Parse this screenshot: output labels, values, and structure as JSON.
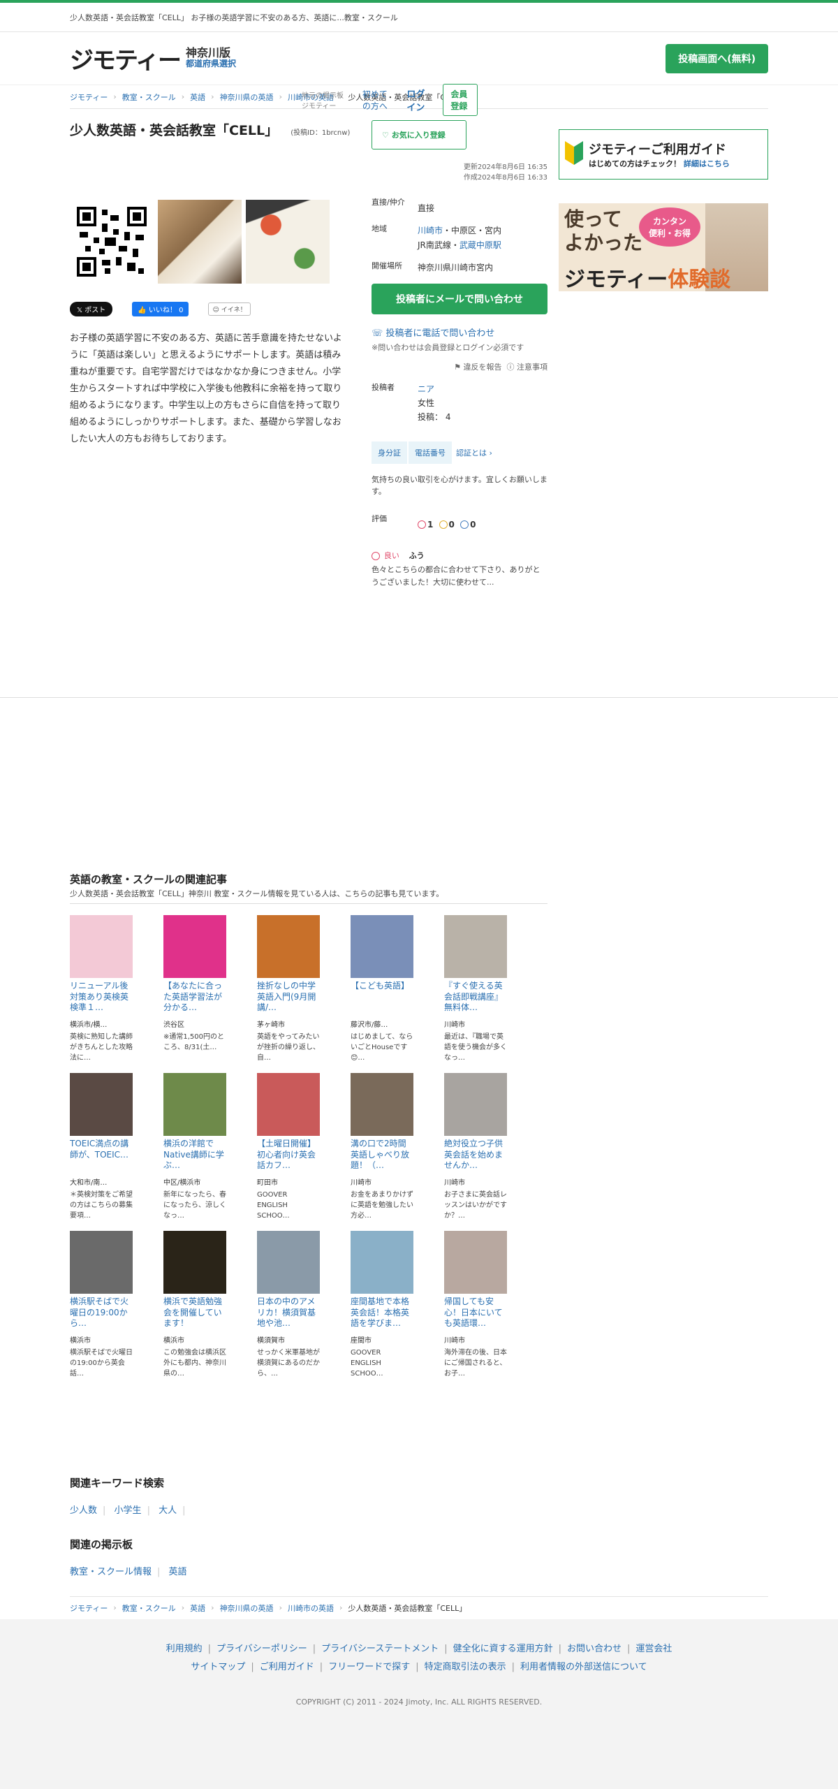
{
  "topbar": {
    "lead": "少人数英語・英会話教室「CELL」 お子様の英語学習に不安のある方、英語に...教室・スクール",
    "site_label": "地元の掲示板 ジモティー",
    "first_time": "初めての方へ",
    "login": "ログイン",
    "signup": "会員登録"
  },
  "header": {
    "logo": "ジモティー",
    "edition": "神奈川版",
    "pref_select": "都道府県選択",
    "post_button": "投稿画面へ(無料)"
  },
  "breadcrumb": [
    "ジモティー",
    "教室・スクール",
    "英語",
    "神奈川県の英語",
    "川崎市の英語",
    "少人数英語・英会話教室「CELL」"
  ],
  "post": {
    "title": "少人数英語・英会話教室「CELL」",
    "post_id": "(投稿ID：1brcnw)",
    "favorite": "お気に入り登録",
    "updated": "更新2024年8月6日 16:35",
    "created": "作成2024年8月6日 16:33",
    "description": "お子様の英語学習に不安のある方、英語に苦手意識を持たせないように「英語は楽しい」と思えるようにサポートします。英語は積み重ねが重要です。自宅学習だけではなかなか身につきません。小学生からスタートすれば中学校に入学後も他教科に余裕を持って取り組めるようになります。中学生以上の方もさらに自信を持って取り組めるようにしっかりサポートします。また、基礎から学習しなおしたい大人の方もお待ちしております。",
    "share": {
      "x": "ポスト",
      "fb": "いいね！ 0",
      "iinee": "イイネ！"
    }
  },
  "info": {
    "direct_label": "直接/仲介",
    "direct_value": "直接",
    "area_label": "地域",
    "area_city": "川崎市",
    "area_rest": "・中原区・宮内",
    "area_line": "JR南武線・",
    "area_station": "武蔵中原駅",
    "venue_label": "開催場所",
    "venue_value": "神奈川県川崎市宮内",
    "mail_button": "投稿者にメールで問い合わせ",
    "tel_link": "投稿者に電話で問い合わせ",
    "login_note": "※問い合わせは会員登録とログイン必須です",
    "report": "違反を報告",
    "caution": "注意事項",
    "poster_label": "投稿者",
    "poster_name": "ニア",
    "poster_gender": "女性",
    "poster_count": "投稿： 4",
    "badge_id": "身分証",
    "badge_tel": "電話番号",
    "cert_link": "認証とは",
    "greeting": "気持ちの良い取引を心がけます。宜しくお願いします。",
    "rating_label": "評価",
    "rating_good": "1",
    "rating_mid": "0",
    "rating_bad": "0",
    "review_tag": "良い",
    "review_user": "ふう",
    "review_text": "色々とこちらの都合に合わせて下さり、ありがとうございました！大切に使わせて..."
  },
  "side": {
    "guide_title": "ジモティーご利用ガイド",
    "guide_sub": "はじめての方はチェック！",
    "guide_link": "詳細はこちら",
    "banner_l1": "使って",
    "banner_l2": "よかった",
    "banner_brand": "ジモティー",
    "banner_tail": "体験談",
    "banner_bubble1": "カンタン",
    "banner_bubble2": "便利・お得"
  },
  "related": {
    "title": "英語の教室・スクールの関連記事",
    "sub": "少人数英語・英会話教室「CELL」神奈川 教室・スクール情報を見ている人は、こちらの記事も見ています。",
    "cards": [
      {
        "title": "リニューアル後対策あり英検英検準１…",
        "loc": "横浜市/横…",
        "desc": "英検に熟知した講師がきちんとした攻略法に…",
        "color": "#f3c9d6"
      },
      {
        "title": "【あなたに合った英語学習法が分かる…",
        "loc": "渋谷区",
        "desc": "※通常1,500円のところ、8/31(土…",
        "color": "#e0318a"
      },
      {
        "title": "挫折なしの中学英語入門(9月開講/…",
        "loc": "茅ヶ崎市",
        "desc": "英語をやってみたいが挫折の繰り返し、自…",
        "color": "#c8702a"
      },
      {
        "title": "【こども英語】",
        "loc": "藤沢市/藤…",
        "desc": "はじめまして、ならいごとHouseです😊…",
        "color": "#7a8fb8"
      },
      {
        "title": "『すぐ使える英会話即戦講座』無料体…",
        "loc": "川崎市",
        "desc": "最近は、『職場で英語を使う機会が多くなっ…",
        "color": "#b9b2a8"
      },
      {
        "title": "TOEIC満点の講師が、TOEIC…",
        "loc": "大和市/南…",
        "desc": "＊英検対策をご希望の方はこちらの募集要項…",
        "color": "#5a4a44"
      },
      {
        "title": "横浜の洋館でNative講師に学ぶ…",
        "loc": "中区/横浜市",
        "desc": "新年になったら、春になったら、涼しくなっ…",
        "color": "#6e8a4a"
      },
      {
        "title": "【土曜日開催】初心者向け英会話カフ…",
        "loc": "町田市",
        "desc": "GOOVER ENGLISH SCHOO…",
        "color": "#c95a5a"
      },
      {
        "title": "溝の口で2時間英語しゃべり放題！（…",
        "loc": "川崎市",
        "desc": "お金をあまりかけずに英語を勉強したい方必…",
        "color": "#7a6a5a"
      },
      {
        "title": "絶対役立つ子供英会話を始めませんか…",
        "loc": "川崎市",
        "desc": "お子さまに英会話レッスンはいかがですか？…",
        "color": "#a8a4a0"
      },
      {
        "title": "横浜駅そばで火曜日の19:00から…",
        "loc": "横浜市",
        "desc": "横浜駅そばで火曜日の19:00から英会話…",
        "color": "#6a6a6a"
      },
      {
        "title": "横浜で英語勉強会を開催しています！",
        "loc": "横浜市",
        "desc": "この勉強会は横浜区外にも都内、神奈川県の…",
        "color": "#2a2418"
      },
      {
        "title": "日本の中のアメリカ！横須賀基地や池…",
        "loc": "横須賀市",
        "desc": "せっかく米軍基地が横須賀にあるのだから、…",
        "color": "#8a9aa8"
      },
      {
        "title": "座間基地で本格英会話！本格英語を学びま…",
        "loc": "座間市",
        "desc": "GOOVER ENGLISH SCHOO…",
        "color": "#8ab0c8"
      },
      {
        "title": "帰国しても安心！日本にいても英語環…",
        "loc": "川崎市",
        "desc": "海外滞在の後、日本にご帰国されると、お子…",
        "color": "#b8a8a0"
      }
    ]
  },
  "keywords": {
    "title": "関連キーワード検索",
    "items": [
      "少人数",
      "小学生",
      "大人"
    ]
  },
  "boards": {
    "title": "関連の掲示板",
    "items": [
      "教室・スクール情報",
      "英語"
    ]
  },
  "footer": {
    "row1": [
      "利用規約",
      "プライバシーポリシー",
      "プライバシーステートメント",
      "健全化に資する運用方針",
      "お問い合わせ",
      "運営会社"
    ],
    "row2": [
      "サイトマップ",
      "ご利用ガイド",
      "フリーワードで探す",
      "特定商取引法の表示",
      "利用者情報の外部送信について"
    ],
    "copyright": "COPYRIGHT (C) 2011 - 2024 Jimoty, Inc. ALL RIGHTS RESERVED."
  },
  "colors": {
    "accent": "#2aa35b",
    "link": "#2a6fb0"
  }
}
